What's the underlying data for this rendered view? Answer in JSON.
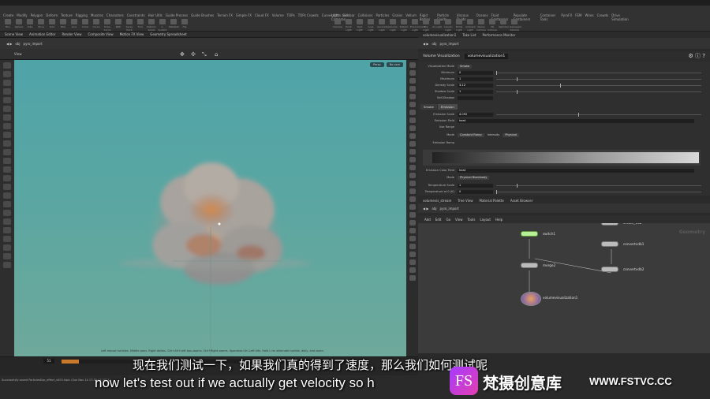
{
  "shelf": {
    "tabs_left": [
      "Create",
      "Modify",
      "Polygon",
      "Deform",
      "Texture",
      "Rigging",
      "Muscles",
      "Characters",
      "Constraints",
      "Hair Utils",
      "Guide Process",
      "Guide Brushes",
      "Terrain FX",
      "Simple FX",
      "Cloud FX",
      "Volume",
      "TOPs",
      "TOPs Crowds",
      "Curves/Attr",
      "Sidebar"
    ],
    "tabs_right": [
      "Lights and Cameras",
      "Collisions",
      "Particles",
      "Grains",
      "Vellum",
      "Rigid Bodies",
      "Particle Fluids",
      "Viscous Fluids",
      "Oceans",
      "Fluid Containers",
      "Populate Containers",
      "Container Tools",
      "PyroFX",
      "FEM",
      "Wires",
      "Crowds",
      "Drive Simulation"
    ],
    "tools_left": [
      "Box",
      "Sphere",
      "Tube",
      "Torus",
      "Grid",
      "Null",
      "Line",
      "Circle",
      "Curve",
      "Draw Curve",
      "Path",
      "Spray Paint",
      "Font",
      "Platonic Solids",
      "L-System",
      "Metaball",
      "File"
    ],
    "tools_right": [
      "Camera",
      "Point Light",
      "Spot Light",
      "Area Light",
      "Geometry Light",
      "Volume Light",
      "Distant Light",
      "Environment Light",
      "Sky Light",
      "GI Light",
      "Caustic Light",
      "Portal Light",
      "Ambient Light",
      "Stereo Camera",
      "VR Camera",
      "Switcher",
      "Gamepad Camera"
    ]
  },
  "left_pane": {
    "tabs": [
      "Scene View",
      "Animation Editor",
      "Render View",
      "Composite View",
      "Motion FX View",
      "Geometry Spreadsheet"
    ],
    "path": [
      "obj",
      "pyro_import"
    ],
    "view_label": "View",
    "persp_button": "Persp",
    "cam_button": "No cam",
    "hint": "Left mouse tumbles. Middle pans. Right dollies. Ctrl+Alt+Left box-zooms. Ctrl+Right zooms. Spacebar-Ctrl-Left tilts. Hold L for alternate tumble, dolly, and zoom.",
    "frame": "51",
    "status": "Successfully saved ParticlesExp_effect_v003.hiplc (Sun Nov 14 17:38:03 2021)"
  },
  "params": {
    "tabs": [
      "volumevisualization1",
      "Take List",
      "Performance Monitor"
    ],
    "path": [
      "obj",
      "pyro_import"
    ],
    "node_type": "Volume Visualization",
    "node_name": "volumevisualization1",
    "rows": [
      {
        "label": "Visualization Mode",
        "dropdown": "Smoke"
      },
      {
        "label": "Minimum",
        "value": "0",
        "frac": 0.0
      },
      {
        "label": "Maximum",
        "value": "1",
        "frac": 0.1
      },
      {
        "label": "Density Scale",
        "value": "3.12",
        "frac": 0.31
      },
      {
        "label": "Shadow Scale",
        "value": "1",
        "frac": 0.1
      },
      {
        "label": "Self-Shadow",
        "value": ""
      }
    ],
    "section_tabs": [
      "Smoke",
      "Emission"
    ],
    "emission_scale": {
      "label": "Emission Scale",
      "value": "4.092",
      "frac": 0.4
    },
    "emission_field": {
      "label": "Emission Field",
      "value": "heat"
    },
    "use_range": "Use Range",
    "mode": {
      "label": "Mode",
      "dropdown": "Constant Ramp",
      "label2": "Intensity",
      "dropdown2": "Physical"
    },
    "ramp_label": "Emission Ramp",
    "color_field": {
      "label": "Emission Color Field",
      "value": "heat"
    },
    "color_mode": {
      "label": "Mode",
      "dropdown": "Physical Blackbody"
    },
    "temp_scale": {
      "label": "Temperature Scale",
      "value": "1",
      "frac": 0.1
    },
    "temp_k": {
      "label": "Temperature at 0 (K)",
      "value": "0",
      "frac": 0.0
    }
  },
  "network": {
    "tabs": [
      "volumevis_stream",
      "Tree View",
      "Material Palette",
      "Asset Browser"
    ],
    "path": [
      "obj",
      "pyro_import"
    ],
    "menu": [
      "Add",
      "Edit",
      "Go",
      "View",
      "Tools",
      "Layout",
      "Help"
    ],
    "context_label": "Geometry",
    "nodes": [
      {
        "name": "switch1"
      },
      {
        "name": "merge2"
      },
      {
        "name": "volumevisualization1"
      },
      {
        "name": "convertvdb1"
      },
      {
        "name": "convertvdb2"
      },
      {
        "name": "create_vdb"
      }
    ]
  },
  "subtitles": {
    "chinese": "现在我们测试一下，如果我们真的得到了速度，那么我们如何测试呢",
    "english": "now let's test out if we actually get velocity so h"
  },
  "watermark": {
    "logo": "FS",
    "name": "梵摄创意库",
    "url": "WWW.FSTVC.CC"
  },
  "colors": {
    "viewport_top": "#4fa4a8",
    "viewport_bottom": "#6ea99b",
    "accent_purple": "#a63aff",
    "cache_orange": "#c87a2a"
  }
}
